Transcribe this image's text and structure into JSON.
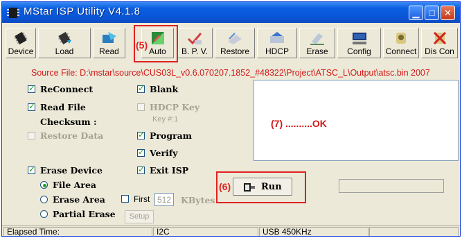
{
  "window": {
    "title": "MStar ISP Utility V4.1.8"
  },
  "colors": {
    "titlebar": "#0a5fe0",
    "annotation_red": "#e02020",
    "source_text": "#d01818",
    "check_green": "#21a121"
  },
  "toolbar": {
    "items": [
      {
        "label": "Device",
        "icon": "device-chip-icon"
      },
      {
        "label": "Load",
        "icon": "load-chip-icon"
      },
      {
        "label": "Read",
        "icon": "read-icon"
      },
      {
        "label": "Auto",
        "icon": "auto-icon"
      },
      {
        "label": "B. P. V.",
        "icon": "bpv-check-icon"
      },
      {
        "label": "Restore",
        "icon": "restore-icon"
      },
      {
        "label": "HDCP",
        "icon": "hdcp-icon"
      },
      {
        "label": "Erase",
        "icon": "erase-icon"
      },
      {
        "label": "Config",
        "icon": "config-icon"
      },
      {
        "label": "Connect",
        "icon": "connect-icon"
      },
      {
        "label": "Dis Con",
        "icon": "disconnect-icon"
      }
    ]
  },
  "source_file": "Source File: D:\\mstar\\source\\CUS03L_v0.6.070207.1852_#48322\\Project\\ATSC_L\\Output\\atsc.bin 2007",
  "options": {
    "reconnect": {
      "label": "ReConnect",
      "checked": true
    },
    "read_file": {
      "label": "Read File",
      "checked": true
    },
    "checksum_label": "Checksum :",
    "restore_data": {
      "label": "Restore Data",
      "checked": false,
      "disabled": true
    },
    "erase_device": {
      "label": "Erase Device",
      "checked": true
    },
    "file_area": "File Area",
    "erase_area": "Erase Area",
    "partial_erase": "Partial Erase",
    "blank": {
      "label": "Blank",
      "checked": true
    },
    "hdcp_key": {
      "label": "HDCP Key",
      "checked": false,
      "disabled": true
    },
    "key_number": "Key #:1",
    "program": {
      "label": "Program",
      "checked": true
    },
    "verify": {
      "label": "Verify",
      "checked": true
    },
    "exit_isp": {
      "label": "Exit ISP",
      "checked": true
    },
    "first": {
      "label": "First",
      "value": "512",
      "unit": "KBytes"
    },
    "setup_label": "Setup"
  },
  "run_button": {
    "label": "Run"
  },
  "status_message": "(7) ..........OK",
  "annotations": {
    "auto": "(5)",
    "run": "(6)"
  },
  "status_bar": {
    "elapsed": "Elapsed Time:",
    "interface": "I2C",
    "speed": "USB  450KHz"
  }
}
